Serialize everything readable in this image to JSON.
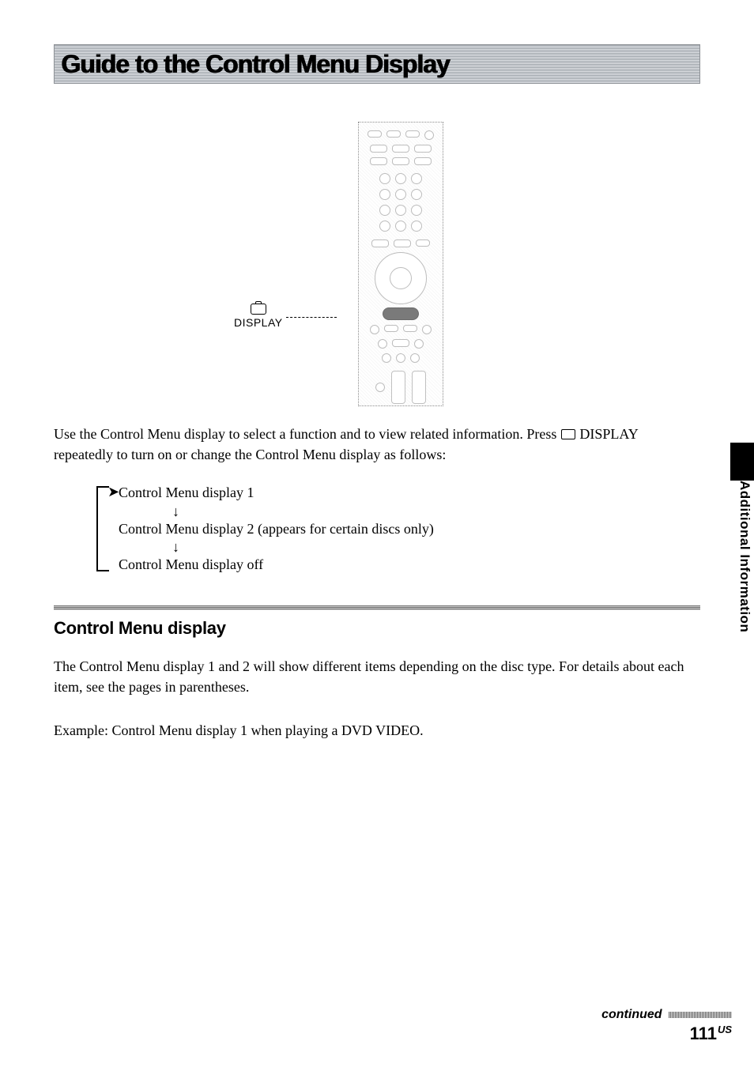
{
  "header": {
    "title": "Guide to the Control Menu Display"
  },
  "callout": {
    "display_label": "DISPLAY"
  },
  "intro": {
    "line1a": "Use the Control Menu display to select a function and to view related information. Press ",
    "line1b": " DISPLAY repeatedly to turn on or change the Control Menu display as follows:"
  },
  "flow": {
    "item1": "Control Menu display 1",
    "item2": "Control Menu display 2 (appears for certain discs only)",
    "item3": "Control Menu display off"
  },
  "section": {
    "subhead": "Control Menu display",
    "para1": "The Control Menu display 1 and 2 will show different items depending on the disc type. For details about each item, see the pages in parentheses.",
    "para2": "Example: Control Menu display 1 when playing a DVD VIDEO."
  },
  "side": {
    "label": "Additional Information"
  },
  "footer": {
    "continued": "continued",
    "page_number": "111",
    "page_suffix": "US"
  }
}
